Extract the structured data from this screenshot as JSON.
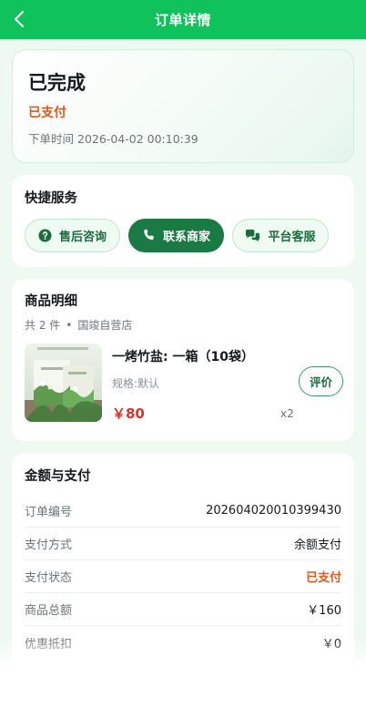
{
  "nav": {
    "title": "订单详情",
    "back_icon": "chevron-left-icon"
  },
  "status": {
    "title": "已完成",
    "pay_status": "已支付",
    "order_time_label": "下单时间",
    "order_time": "2026-04-02 00:10:39"
  },
  "services": {
    "title": "快捷服务",
    "buttons": [
      {
        "label": "售后咨询",
        "icon": "question-circle-icon",
        "style": "light"
      },
      {
        "label": "联系商家",
        "icon": "phone-icon",
        "style": "dark"
      },
      {
        "label": "平台客服",
        "icon": "chat-bubbles-icon",
        "style": "light"
      }
    ]
  },
  "goods": {
    "title": "商品明细",
    "count_text": "共 2 件",
    "separator": "•",
    "store": "国竣自营店",
    "item": {
      "name": "一烤竹盐: 一箱（10袋）",
      "spec": "规格:默认",
      "price": "￥80",
      "qty": "x2",
      "review_label": "评价"
    }
  },
  "payment": {
    "title": "金额与支付",
    "rows": [
      {
        "label": "订单编号",
        "value": "202604020010399430"
      },
      {
        "label": "支付方式",
        "value": "余额支付"
      },
      {
        "label": "支付状态",
        "value": "已支付"
      },
      {
        "label": "商品总额",
        "value": "￥160"
      },
      {
        "label": "优惠抵扣",
        "value": "￥0"
      }
    ]
  },
  "colors": {
    "brand_green": "#0fc25b",
    "dark_green": "#1a7a43",
    "paid_orange": "#e2591b",
    "price_red": "#d8342c"
  }
}
